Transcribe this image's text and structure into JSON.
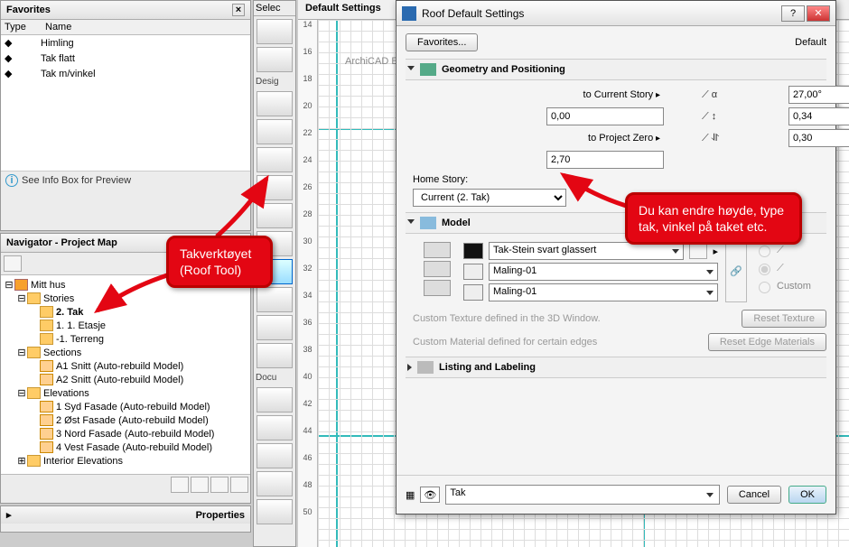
{
  "favorites": {
    "title": "Favorites",
    "col_type": "Type",
    "col_name": "Name",
    "items": [
      "Himling",
      "Tak flatt",
      "Tak m/vinkel"
    ],
    "info_note": "See Info Box for Preview"
  },
  "navigator": {
    "title": "Navigator - Project Map",
    "root": "Mitt hus",
    "stories_label": "Stories",
    "stories": [
      "2. Tak",
      "1. 1. Etasje",
      "-1. Terreng"
    ],
    "sections_label": "Sections",
    "sections": [
      "A1 Snitt (Auto-rebuild Model)",
      "A2 Snitt (Auto-rebuild Model)"
    ],
    "elevations_label": "Elevations",
    "elevations": [
      "1 Syd Fasade (Auto-rebuild Model)",
      "2 Øst Fasade (Auto-rebuild Model)",
      "3 Nord Fasade (Auto-rebuild Model)",
      "4 Vest Fasade (Auto-rebuild Model)"
    ],
    "interior_label": "Interior Elevations"
  },
  "properties": {
    "title": "Properties"
  },
  "toolbox": {
    "title": "Selec",
    "g1": "Desig",
    "g2": "Docu"
  },
  "canvas": {
    "tab": "Default Settings",
    "watermark": "ArchiCAD Education",
    "ruler": [
      "14",
      "16",
      "18",
      "20",
      "22",
      "24",
      "26",
      "28",
      "30",
      "32",
      "34",
      "36",
      "38",
      "40",
      "42",
      "44",
      "46",
      "48",
      "50"
    ]
  },
  "dialog": {
    "title": "Roof Default Settings",
    "favorites_btn": "Favorites...",
    "default_label": "Default",
    "sec_geo": "Geometry and Positioning",
    "to_current": "to Current Story",
    "val_current": "0,00",
    "to_zero": "to Project Zero",
    "val_zero": "2,70",
    "angle": "27,00°",
    "rise": "0,34",
    "thick": "0,30",
    "home_story": "Home Story:",
    "home_story_val": "Current (2. Tak)",
    "sec_model": "Model",
    "mat_top": "Tak-Stein svart glassert",
    "mat_side": "Maling-01",
    "mat_bot": "Maling-01",
    "custom_radio": "Custom",
    "note1": "Custom Texture defined in the 3D Window.",
    "note2": "Custom Material defined for certain edges",
    "btn_reset_tex": "Reset Texture",
    "btn_reset_edge": "Reset Edge Materials",
    "sec_listing": "Listing and Labeling",
    "layer": "Tak",
    "cancel": "Cancel",
    "ok": "OK"
  },
  "callouts": {
    "roof_tool": "Takverktøyet\n(Roof Tool)",
    "height": "Du kan endre høyde, type tak, vinkel på taket etc."
  }
}
